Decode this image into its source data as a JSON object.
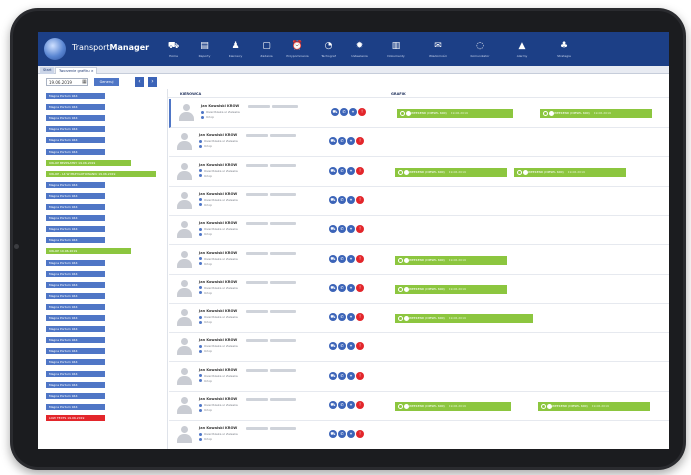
{
  "app": {
    "brand_light": "Transport",
    "brand_bold": "Manager"
  },
  "nav": [
    {
      "label": "Home",
      "icon": "truck-icon",
      "glyph": "⛟"
    },
    {
      "label": "Raporty",
      "icon": "document-icon",
      "glyph": "▤"
    },
    {
      "label": "Kierowcy",
      "icon": "driver-icon",
      "glyph": "♟"
    },
    {
      "label": "Zadania",
      "icon": "clipboard-icon",
      "glyph": "▢"
    },
    {
      "label": "Przypomnienia",
      "icon": "bell-icon",
      "glyph": "⏰"
    },
    {
      "label": "Tachograf",
      "icon": "speedometer-icon",
      "glyph": "◔"
    },
    {
      "label": "Ustawienia",
      "icon": "gear-icon",
      "glyph": "✹"
    },
    {
      "label": "Dokumenty",
      "icon": "file-icon",
      "glyph": "▥"
    },
    {
      "label": "Wiadomości",
      "icon": "chat-icon",
      "glyph": "✉",
      "badge": true
    },
    {
      "label": "Komunikator",
      "icon": "message-icon",
      "glyph": "◌"
    },
    {
      "label": "Alarmy",
      "icon": "warning-icon",
      "glyph": "▲"
    },
    {
      "label": "Strategia",
      "icon": "plant-icon",
      "glyph": "♣"
    }
  ],
  "tabs": [
    "Start",
    "Tworzenie grafiku ×"
  ],
  "toolbar": {
    "date": "19.06.2019",
    "generate": "Generuj",
    "prev": "‹",
    "next": "›"
  },
  "columns": {
    "driver": "KIEROWCA",
    "schedule": "GRAFIK"
  },
  "left_items": [
    {
      "text": "Magna Portum 944",
      "kind": "blue"
    },
    {
      "text": "Magna Portum 944",
      "kind": "blue"
    },
    {
      "text": "Magna Portum 944",
      "kind": "blue"
    },
    {
      "text": "Magna Portum 944",
      "kind": "blue"
    },
    {
      "text": "Magna Portum 944",
      "kind": "blue"
    },
    {
      "text": "Magna Portum 944",
      "kind": "blue"
    },
    {
      "text": "URLOP BEZPŁATNY    19.06.2019",
      "kind": "green"
    },
    {
      "text": "URLOP - L4 W PRZYGOTOWANIU    19.06.2019",
      "kind": "green2"
    },
    {
      "text": "Magna Portum 944",
      "kind": "blue"
    },
    {
      "text": "Magna Portum 944",
      "kind": "blue"
    },
    {
      "text": "Magna Portum 944",
      "kind": "blue"
    },
    {
      "text": "Magna Portum 944",
      "kind": "blue"
    },
    {
      "text": "Magna Portum 944",
      "kind": "blue"
    },
    {
      "text": "Magna Portum 944",
      "kind": "blue"
    },
    {
      "text": "URLOP    19.06.2019",
      "kind": "green"
    },
    {
      "text": "Magna Portum 944",
      "kind": "blue"
    },
    {
      "text": "Magna Portum 944",
      "kind": "blue"
    },
    {
      "text": "Magna Portum 944",
      "kind": "blue"
    },
    {
      "text": "Magna Portum 944",
      "kind": "blue"
    },
    {
      "text": "Magna Portum 944",
      "kind": "blue"
    },
    {
      "text": "Magna Portum 944",
      "kind": "blue"
    },
    {
      "text": "Magna Portum 944",
      "kind": "blue"
    },
    {
      "text": "Magna Portum 944",
      "kind": "blue"
    },
    {
      "text": "Magna Portum 944",
      "kind": "blue"
    },
    {
      "text": "Magna Portum 944",
      "kind": "blue"
    },
    {
      "text": "Magna Portum 944",
      "kind": "blue"
    },
    {
      "text": "Magna Portum 944",
      "kind": "blue"
    },
    {
      "text": "Magna Portum 944",
      "kind": "blue"
    },
    {
      "text": "Magna Portum 944",
      "kind": "blue"
    },
    {
      "text": "LOW TEXTS   19.06.2019",
      "kind": "red"
    }
  ],
  "rows": [
    {
      "name": "Jan Kowalski   KROW",
      "line1": "Osiel Rzeka ul Zaleska",
      "line2": "Urlop",
      "bars": [
        {
          "text": "WEEKEND (DIESEL 600)",
          "sub": "19.06.2019"
        },
        {
          "text": "WEEKEND (DIESEL 600)",
          "sub": "19.06.2019"
        }
      ]
    },
    {
      "name": "Jan Kowalski   KROW",
      "line1": "Osiel Rzeka ul Zaleska",
      "line2": "Urlop",
      "bars": []
    },
    {
      "name": "Jan Kowalski   KROW",
      "line1": "Osiel Rzeka ul Zaleska",
      "line2": "Urlop",
      "bars": [
        {
          "text": "WEEKEND (DIESEL 600)",
          "sub": "19.06.2019"
        },
        {
          "text": "WEEKEND (DIESEL 600)",
          "sub": "19.06.2019"
        }
      ]
    },
    {
      "name": "Jan Kowalski   KROW",
      "line1": "Osiel Rzeka ul Zaleska",
      "line2": "Urlop",
      "bars": []
    },
    {
      "name": "Jan Kowalski   KROW",
      "line1": "Osiel Rzeka ul Zaleska",
      "line2": "Urlop",
      "bars": []
    },
    {
      "name": "Jan Kowalski   KROW",
      "line1": "Osiel Rzeka ul Zaleska",
      "line2": "Urlop",
      "bars": [
        {
          "text": "WEEKEND (DIESEL 600)",
          "sub": "19.06.2019"
        }
      ]
    },
    {
      "name": "Jan Kowalski   KROW",
      "line1": "Osiel Rzeka ul Zaleska",
      "line2": "Urlop",
      "bars": [
        {
          "text": "WEEKEND (DIESEL 600)",
          "sub": "19.06.2019"
        }
      ]
    },
    {
      "name": "Jan Kowalski   KROW",
      "line1": "Osiel Rzeka ul Zaleska",
      "line2": "Urlop",
      "bars": [
        {
          "text": "WEEKEND (DIESEL 600)",
          "sub": "19.06.2019"
        }
      ]
    },
    {
      "name": "Jan Kowalski   KROW",
      "line1": "Osiel Rzeka ul Zaleska",
      "line2": "Urlop",
      "bars": []
    },
    {
      "name": "Jan Kowalski   KROW",
      "line1": "Osiel Rzeka ul Zaleska",
      "line2": "Urlop",
      "bars": []
    },
    {
      "name": "Jan Kowalski   KROW",
      "line1": "Osiel Rzeka ul Zaleska",
      "line2": "Urlop",
      "bars": [
        {
          "text": "WEEKEND (DIESEL 600)",
          "sub": "19.06.2019"
        },
        {
          "text": "WEEKEND (DIESEL 600)",
          "sub": "19.06.2019"
        }
      ]
    },
    {
      "name": "Jan Kowalski   KROW",
      "line1": "Osiel Rzeka ul Zaleska",
      "line2": "Urlop",
      "bars": []
    }
  ],
  "action_icons": [
    "car-icon",
    "phone-icon",
    "location-icon",
    "alert-icon"
  ],
  "colors": {
    "navbar": "#1c3f86",
    "accent_blue": "#4f76c6",
    "green": "#8cc63f",
    "red": "#e3262b"
  }
}
